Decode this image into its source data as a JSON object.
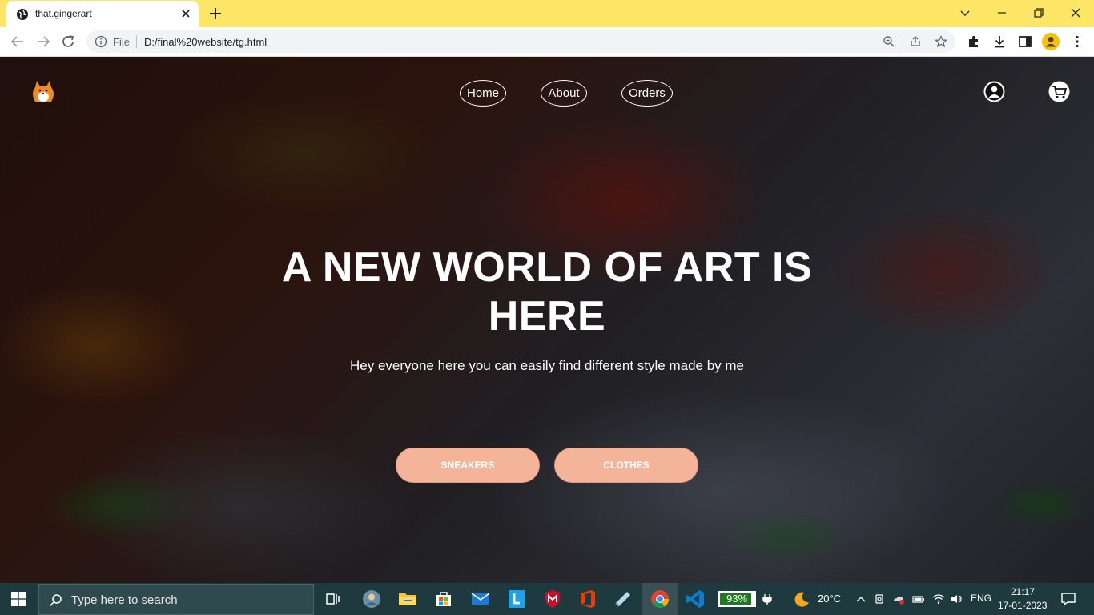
{
  "browser": {
    "tab_title": "that.gingerart",
    "omnibox_scheme": "File",
    "url": "D:/final%20website/tg.html"
  },
  "site": {
    "nav": [
      "Home",
      "About",
      "Orders"
    ],
    "hero_title": "A NEW WORLD OF ART IS HERE",
    "hero_subtitle": "Hey everyone here you can easily find different style made by me",
    "buttons": [
      "SNEAKERS",
      "CLOTHES"
    ],
    "colors": {
      "button_bg": "#f4b49a",
      "tab_strip": "#fde566"
    }
  },
  "taskbar": {
    "search_placeholder": "Type here to search",
    "battery": "93%",
    "battery_level": 0.93,
    "weather": "20°C",
    "language": "ENG",
    "time": "21:17",
    "date": "17-01-2023"
  }
}
